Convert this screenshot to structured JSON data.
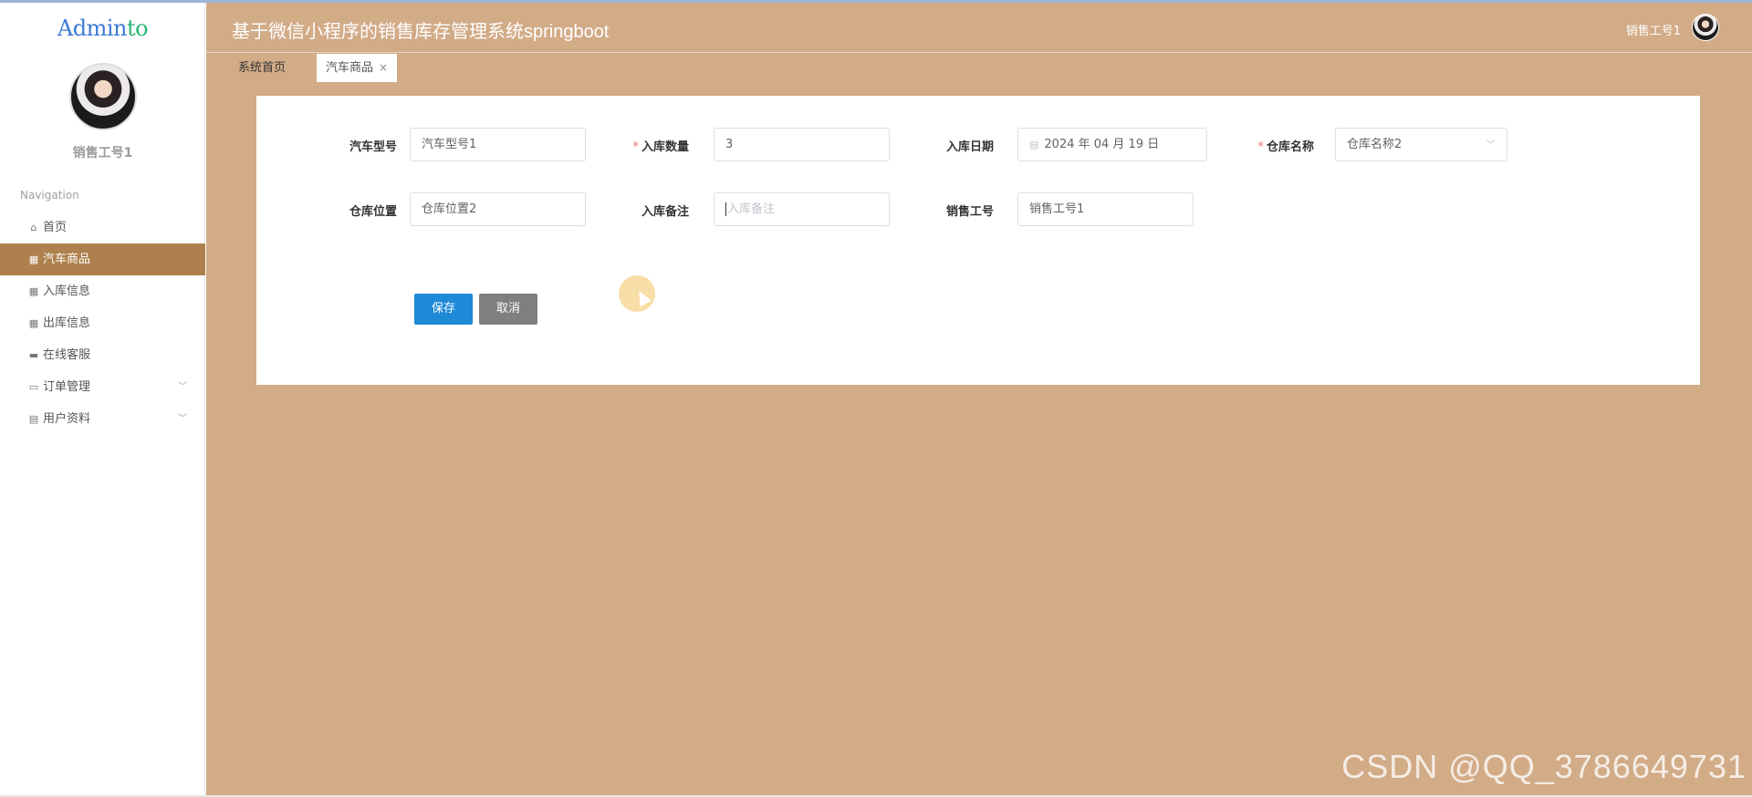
{
  "sidebar": {
    "brand": "Admin",
    "brand_accent": "to",
    "username": "销售工号1",
    "nav_header": "Navigation",
    "items": [
      {
        "label": "首页",
        "icon": "home-icon"
      },
      {
        "label": "汽车商品",
        "icon": "grid-icon"
      },
      {
        "label": "入库信息",
        "icon": "grid-icon"
      },
      {
        "label": "出库信息",
        "icon": "grid-icon"
      },
      {
        "label": "在线客服",
        "icon": "briefcase-icon"
      },
      {
        "label": "订单管理",
        "icon": "monitor-icon"
      },
      {
        "label": "用户资料",
        "icon": "card-icon"
      }
    ],
    "active_index": 1
  },
  "header": {
    "title": "基于微信小程序的销售库存管理系统springboot",
    "user": "销售工号1"
  },
  "tabs": [
    {
      "label": "系统首页"
    },
    {
      "label": "汽车商品",
      "close": "×"
    }
  ],
  "form": {
    "car_model": {
      "label": "汽车型号",
      "value": "汽车型号1"
    },
    "quantity": {
      "label": "入库数量",
      "required": "*",
      "value": "3"
    },
    "date": {
      "label": "入库日期",
      "value": "2024 年 04 月 19 日"
    },
    "warehouse_name": {
      "label": "仓库名称",
      "required": "*",
      "value": "仓库名称2"
    },
    "warehouse_location": {
      "label": "仓库位置",
      "value": "仓库位置2"
    },
    "remark": {
      "label": "入库备注",
      "placeholder": "入库备注"
    },
    "sales_id": {
      "label": "销售工号",
      "value": "销售工号1"
    }
  },
  "buttons": {
    "save": "保存",
    "cancel": "取消"
  },
  "watermark": "CSDN @QQ_3786649731",
  "colors": {
    "header_bg": "#d2ab87",
    "active_menu": "#ae804d",
    "primary": "#1e89d7",
    "cancel": "#7f7f82",
    "required": "#f56c6c"
  }
}
